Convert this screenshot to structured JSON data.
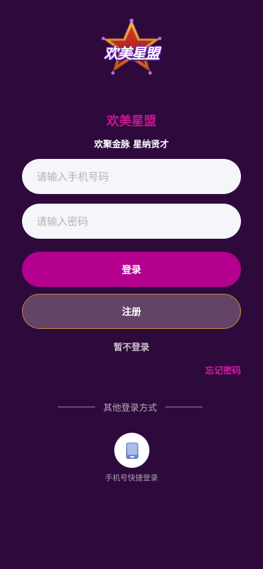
{
  "logo": {
    "text": "欢美星盟"
  },
  "app_name": "欢美星盟",
  "slogan": "欢聚金脉 星纳贤才",
  "form": {
    "phone_placeholder": "请输入手机号码",
    "password_placeholder": "请输入密码",
    "login_label": "登录",
    "register_label": "注册",
    "skip_label": "暂不登录",
    "forgot_label": "忘记密码"
  },
  "other_login": {
    "title": "其他登录方式",
    "options": [
      {
        "icon": "phone-icon",
        "label": "手机号快捷登录"
      }
    ]
  },
  "colors": {
    "background": "#2e0a3c",
    "accent": "#b5008f",
    "app_name": "#c6178f",
    "register_bg": "#634468",
    "register_border": "#c98736",
    "forgot": "#d61ba6"
  }
}
